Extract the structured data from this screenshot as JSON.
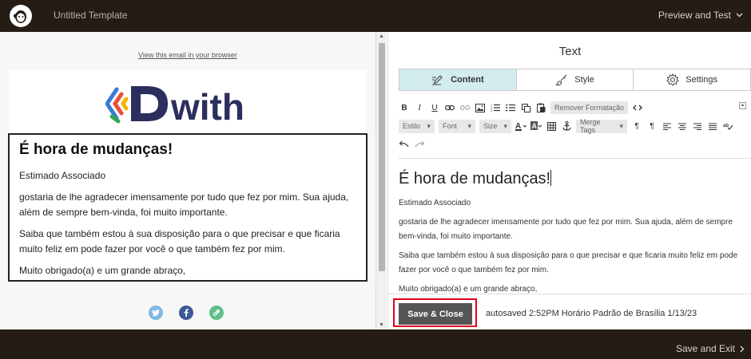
{
  "app": {
    "template_title": "Untitled Template",
    "preview_label": "Preview and Test",
    "save_exit_label": "Save and Exit"
  },
  "preview": {
    "view_in_browser": "View this email in your browser",
    "logo_text": "with",
    "heading": "É hora de mudanças!",
    "greeting": "Estimado Associado",
    "para1": "gostaria de lhe agradecer imensamente por tudo que fez por mim. Sua ajuda, além de sempre bem-vinda, foi muito importante.",
    "para2": "Saiba que também estou à sua disposição para o que precisar e que ficaria muito feliz em pode fazer por você o que também fez por mim.",
    "closing": "Muito obrigado(a) e um grande abraço,"
  },
  "editor": {
    "panel_title": "Text",
    "tabs": [
      {
        "label": "Content"
      },
      {
        "label": "Style"
      },
      {
        "label": "Settings"
      }
    ],
    "toolbar": {
      "bold": "B",
      "italic": "I",
      "underline": "U",
      "remove_format": "Remover Formatação",
      "style_dropdown": "Estilo",
      "font_dropdown": "Font",
      "size_dropdown": "Size",
      "merge_tags": "Merge Tags"
    },
    "content": {
      "heading": "É hora de mudanças!",
      "greeting": "Estimado Associado",
      "para1": "gostaria de lhe agradecer imensamente por tudo que fez por mim. Sua ajuda, além de sempre bem-vinda, foi muito importante.",
      "para2": "Saiba que também estou à sua disposição para o que precisar e que ficaria muito feliz em pode fazer por você o que também fez por mim.",
      "closing": "Muito obrigado(a) e um grande abraço,"
    },
    "save_close_label": "Save & Close",
    "autosave_text": "autosaved 2:52PM Horário Padrão de Brasília 1/13/23"
  },
  "colors": {
    "topbar": "#241c15",
    "active_tab": "#d3ecee",
    "highlight": "#e3001b",
    "logo_navy": "#2b2f5e"
  }
}
